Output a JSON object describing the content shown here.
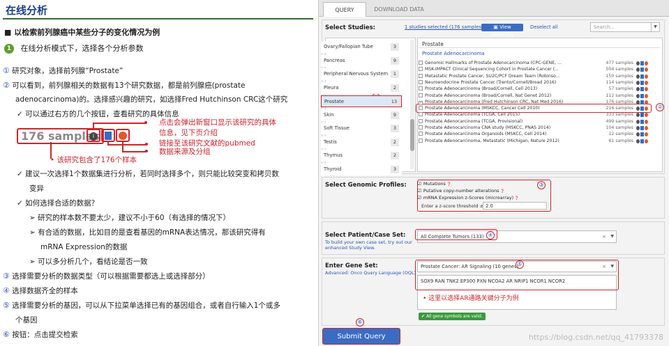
{
  "left": {
    "title": "在线分析",
    "heading": "■ 以检索前列腺癌中某些分子的变化情况为例",
    "step1_num": "1",
    "step1": "在线分析模式下，选择各个分析参数",
    "lines": [
      {
        "n": "①",
        "t": "研究对象，选择前列腺“Prostate”"
      },
      {
        "n": "②",
        "t": "可以看到，前列腺相关的数据有13个研究数据，都是前列腺癌(prostate"
      },
      {
        "n": "",
        "t": "adenocarcinoma)的。选择感兴趣的研究，如选择Fred Hutchinson CRC这个研究"
      },
      {
        "n": "✓",
        "t": "可以通过右方的几个按钮，查看研究的具体信息"
      }
    ],
    "samples_label": "176 samples",
    "ann1": "点击会弹出新窗口显示该研究的具体",
    "ann1b": "信息，见下页介绍",
    "ann2": "链接至该研究文献的pubmed",
    "ann3": "数据来源及分组",
    "ann4": "该研究包含了176个样本",
    "bullets": [
      {
        "n": "✓",
        "t": "建议一次选择1个数据集进行分析，若同时选择多个，则只能比较突变和拷贝数"
      },
      {
        "n": "",
        "t": "变异"
      },
      {
        "n": "✓",
        "t": "如何选择合适的数据？"
      },
      {
        "n": "➢",
        "t": "研究的样本数不要太少，建议不小于60（有选择的情况下）"
      },
      {
        "n": "➢",
        "t": "有合适的数据，比如目的是查看基因的mRNA表达情况，那该研究得有"
      },
      {
        "n": "",
        "t": "mRNA Expression的数据"
      },
      {
        "n": "➢",
        "t": "可以多分析几个，看结论是否一致"
      },
      {
        "n": "③",
        "t": "选择需要分析的数据类型（可以根据需要都选上或选择部分）"
      },
      {
        "n": "④",
        "t": "选择数据齐全的样本"
      },
      {
        "n": "⑤",
        "t": "选择需要分析的基因，可以从下拉菜单选择已有的基因组合，或者自行输入1个或多"
      },
      {
        "n": "",
        "t": "个基因"
      },
      {
        "n": "⑥",
        "t": "按钮：点击提交检索"
      }
    ]
  },
  "right": {
    "tabs": [
      "QUERY",
      "DOWNLOAD DATA"
    ],
    "select_studies": "Select Studies:",
    "selected_info": "1 studies selected (176 samples)",
    "view_summary": "View summary",
    "deselect_all": "Deselect all",
    "search_placeholder": "Search...",
    "categories": [
      {
        "name": "Ovary/Fallopian Tube",
        "count": "3"
      },
      {
        "name": "Pancreas",
        "count": "9"
      },
      {
        "name": "Peripheral Nervous System",
        "count": "1"
      },
      {
        "name": "Pleura",
        "count": "2"
      },
      {
        "name": "Prostate",
        "count": "13"
      },
      {
        "name": "Skin",
        "count": "9"
      },
      {
        "name": "Soft Tissue",
        "count": "3"
      },
      {
        "name": "Testis",
        "count": "2"
      },
      {
        "name": "Thymus",
        "count": "2"
      },
      {
        "name": "Thyroid",
        "count": "3"
      }
    ],
    "group_title": "Prostate",
    "subgroup_title": "Prostate Adenocarcinoma",
    "studies": [
      {
        "name": "Genomic Hallmarks of Prostate Adenocarcinoma (CPC-GENE, ...",
        "samples": "477 samples",
        "checked": false
      },
      {
        "name": "MSK-IMPACT Clinical Sequencing Cohort in Prostate Cancer (...",
        "samples": "504 samples",
        "checked": false
      },
      {
        "name": "Metastatic Prostate Cancer, SU2C/PCF Dream Team (Robinso...",
        "samples": "150 samples",
        "checked": false
      },
      {
        "name": "Neuroendocrine Prostate Cancer (Trento/Cornell/Broad 2016)",
        "samples": "114 samples",
        "checked": false
      },
      {
        "name": "Prostate Adenocarcinoma (Broad/Cornell, Cell 2013)",
        "samples": "57 samples",
        "checked": false
      },
      {
        "name": "Prostate Adenocarcinoma (Broad/Cornell, Nat Genet 2012)",
        "samples": "112 samples",
        "checked": false
      },
      {
        "name": "Prostate Adenocarcinoma (Fred Hutchinson CRC, Nat Med 2016)",
        "samples": "176 samples",
        "checked": true
      },
      {
        "name": "Prostate Adenocarcinoma (MSKCC, Cancer Cell 2010)",
        "samples": "216 samples",
        "checked": false
      },
      {
        "name": "Prostate Adenocarcinoma (TCGA, Cell 2015)",
        "samples": "333 samples",
        "checked": false
      },
      {
        "name": "Prostate Adenocarcinoma (TCGA, Provisional)",
        "samples": "499 samples",
        "checked": false
      },
      {
        "name": "Prostate Adenocarcinoma CNA study (MSKCC, PNAS 2014)",
        "samples": "104 samples",
        "checked": false
      },
      {
        "name": "Prostate Adenocarcinoma Organoids (MSKCC, Cell 2014)",
        "samples": "12 samples",
        "checked": false
      },
      {
        "name": "Prostate Adenocarcinoma, Metastatic (Michigan, Nature 2012)",
        "samples": "61 samples",
        "checked": false
      }
    ],
    "genomic_label": "Select Genomic Profiles:",
    "profiles": [
      "Mutations",
      "Putative copy-number alterations",
      "mRNA Expression z-Scores (microarray)"
    ],
    "zscore_label": "Enter a z-score threshold ±",
    "zscore_value": "2.0",
    "case_label": "Select Patient/Case Set:",
    "case_sub": "To build your own case set, try out our enhanced Study View.",
    "case_value": "All Complete Tumors (133)",
    "gene_label": "Enter Gene Set:",
    "gene_sub": "Advanced: Onco Query Language (OQL)",
    "gene_set_value": "Prostate Cancer: AR Signaling (10 genes)",
    "genes": "SOX9 RAN TNK2 EP300 PXN NCOA2 AR NRIP1 NCOR1 NCOR2",
    "gene_note": "这里以选择AR通路关键分子为例",
    "valid_msg": "All gene symbols are valid.",
    "submit": "Submit Query",
    "watermark": "https://blog.csdn.net/qq_41793378",
    "annotations": [
      "①",
      "②",
      "③",
      "④",
      "⑤",
      "⑥"
    ]
  }
}
